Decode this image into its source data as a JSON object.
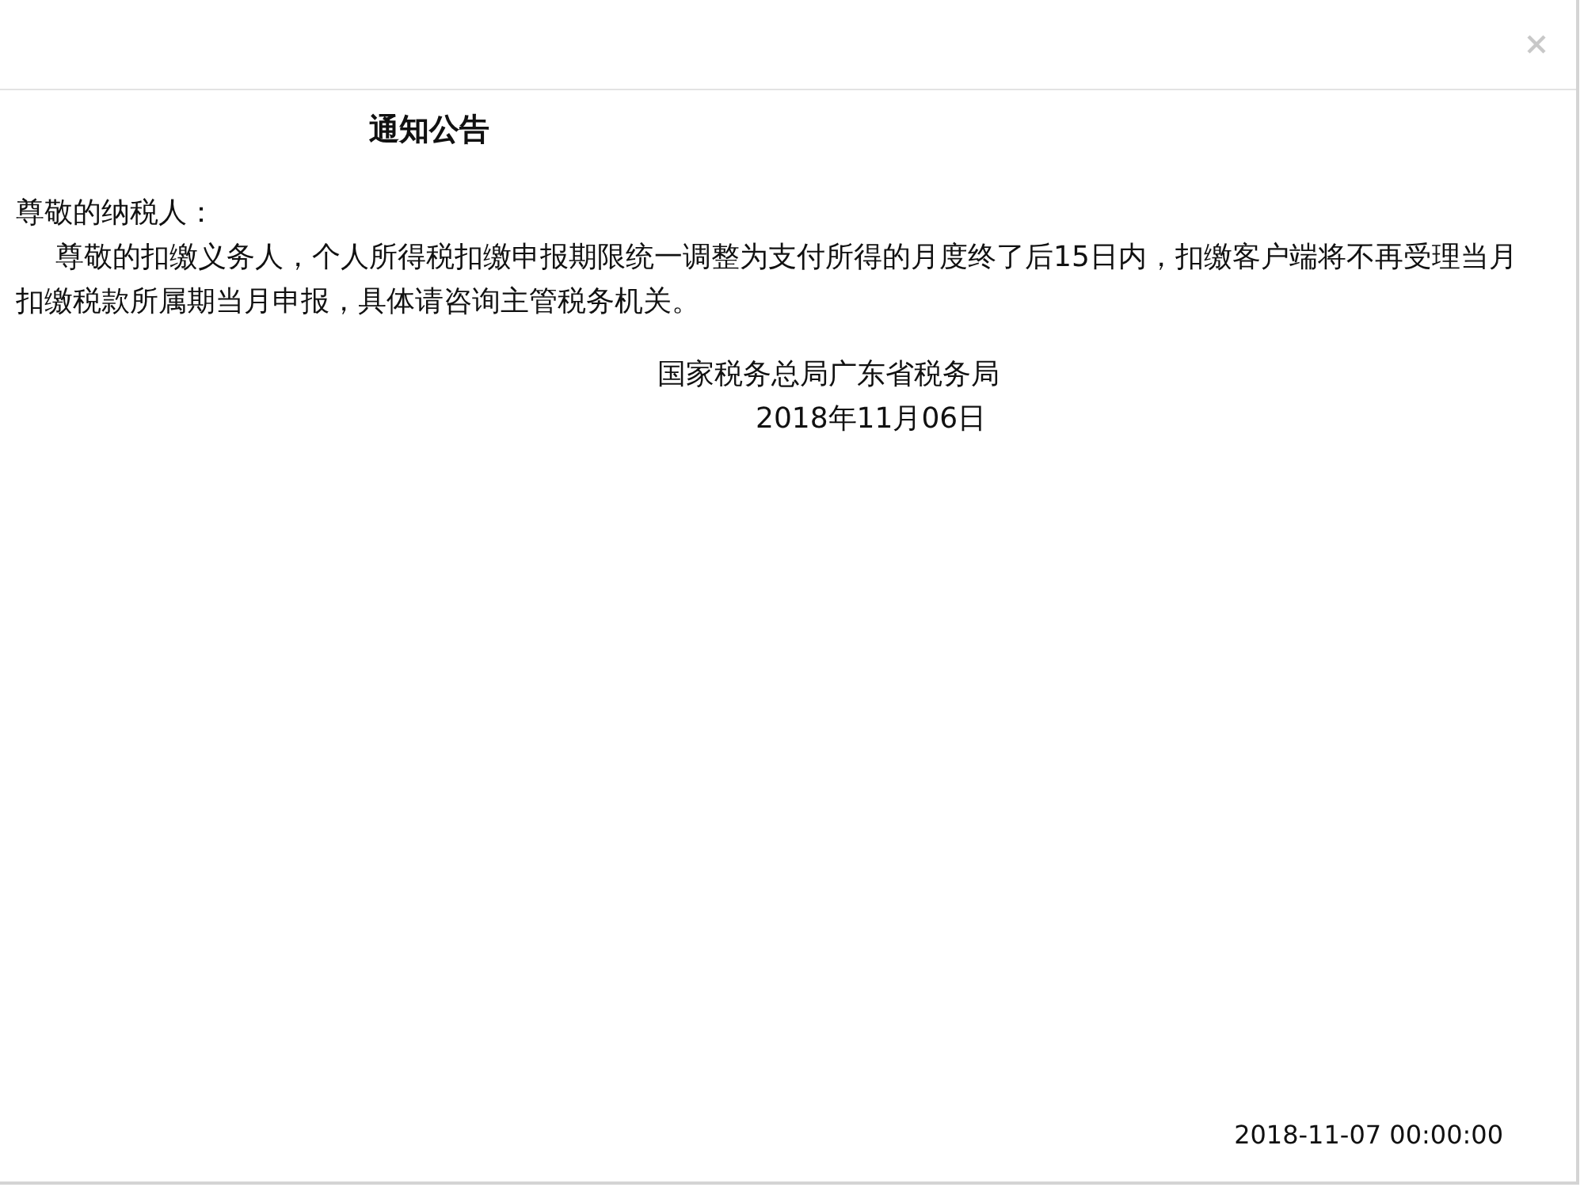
{
  "dialog": {
    "title": "通知公告",
    "greeting": "尊敬的纳税人：",
    "body": "尊敬的扣缴义务人，个人所得税扣缴申报期限统一调整为支付所得的月度终了后15日内，扣缴客户端将不再受理当月扣缴税款所属期当月申报，具体请咨询主管税务机关。",
    "signature": {
      "organization": "国家税务总局广东省税务局",
      "date": "2018年11月06日"
    },
    "timestamp": "2018-11-07 00:00:00"
  }
}
